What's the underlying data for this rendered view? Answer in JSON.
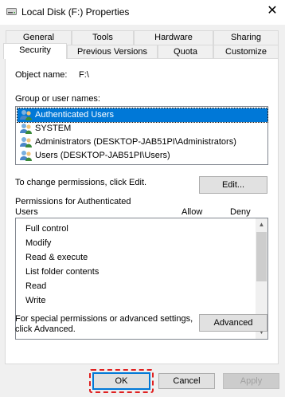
{
  "window": {
    "title": "Local Disk (F:) Properties",
    "close_glyph": "✕"
  },
  "tabs_back": [
    {
      "label": "General"
    },
    {
      "label": "Tools"
    },
    {
      "label": "Hardware"
    },
    {
      "label": "Sharing"
    }
  ],
  "tabs_front": [
    {
      "label": "Security",
      "active": true
    },
    {
      "label": "Previous Versions"
    },
    {
      "label": "Quota"
    },
    {
      "label": "Customize"
    }
  ],
  "object": {
    "label": "Object name:",
    "value": "F:\\"
  },
  "groups": {
    "label": "Group or user names:",
    "items": [
      {
        "name": "Authenticated Users",
        "icon": "users-icon",
        "selected": true
      },
      {
        "name": "SYSTEM",
        "icon": "users-icon"
      },
      {
        "name": "Administrators (DESKTOP-JAB51PI\\Administrators)",
        "icon": "users-icon"
      },
      {
        "name": "Users (DESKTOP-JAB51PI\\Users)",
        "icon": "users-icon"
      }
    ]
  },
  "change_hint": "To change permissions, click Edit.",
  "edit_button": "Edit...",
  "permissions": {
    "label_line1": "Permissions for Authenticated",
    "label_line2": "Users",
    "allow_header": "Allow",
    "deny_header": "Deny",
    "items": [
      "Full control",
      "Modify",
      "Read & execute",
      "List folder contents",
      "Read",
      "Write"
    ]
  },
  "special": {
    "line1": "For special permissions or advanced settings,",
    "line2": "click Advanced.",
    "button": "Advanced"
  },
  "footer": {
    "ok": "OK",
    "cancel": "Cancel",
    "apply": "Apply"
  },
  "colors": {
    "selection": "#0078d7",
    "highlight": "#e02020"
  }
}
